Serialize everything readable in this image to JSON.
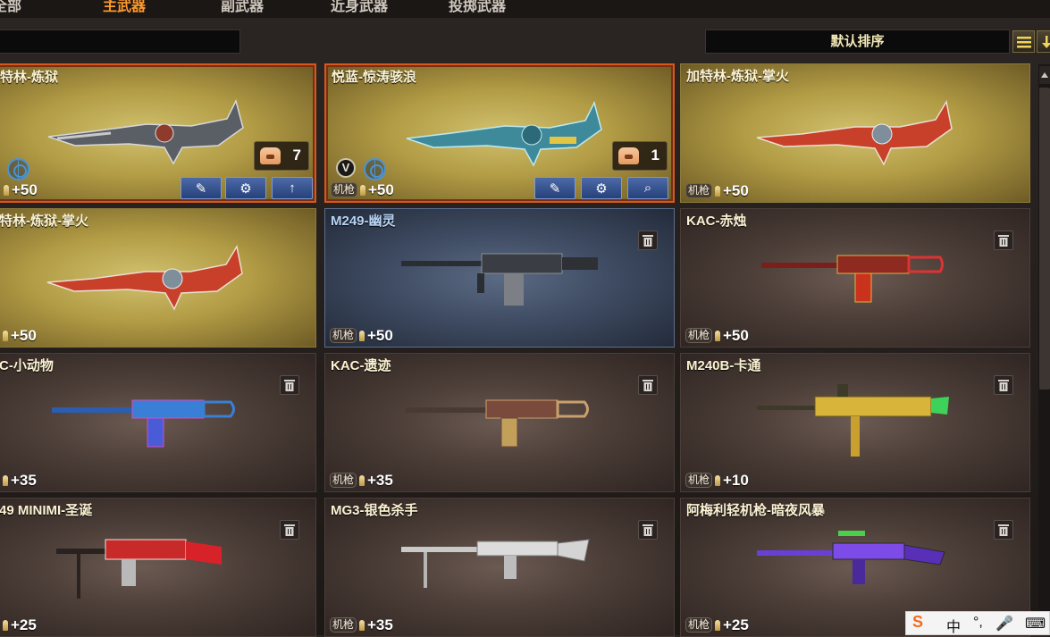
{
  "tabs": [
    {
      "label": "全部"
    },
    {
      "label": "主武器"
    },
    {
      "label": "副武器"
    },
    {
      "label": "近身武器"
    },
    {
      "label": "投掷武器"
    }
  ],
  "search": {
    "placeholder": ""
  },
  "sort": {
    "label": "默认排序"
  },
  "icons": {
    "list": "list-view-icon",
    "sort_direction": "sort-down-icon",
    "trash": "trash-icon",
    "wrench": "wrench-icon",
    "gear": "gear-icon",
    "upgrade": "up-arrow-icon",
    "search": "magnifier-icon",
    "ammo": "bullet-icon"
  },
  "colors": {
    "tab_active": "#ff9a2a",
    "gold_card": "#b29c45",
    "blue_card": "#3f4c63",
    "normal_card": "#4b3d37",
    "selected_border": "#d35a1c"
  },
  "cards": [
    {
      "title": "特林-炼狱",
      "tag": "",
      "ammo": "+50",
      "count": "7",
      "btns": [
        "⚙",
        "⚙",
        "↑"
      ]
    },
    {
      "title": "悦蓝-惊涛骇浪",
      "tag": "机枪",
      "ammo": "+50",
      "count": "1",
      "badge": "V",
      "btns": [
        "⚙",
        "⚙",
        "🔍"
      ]
    },
    {
      "title": "加特林-炼狱-掌火",
      "tag": "机枪",
      "ammo": "+50"
    },
    {
      "title": "特林-炼狱-掌火",
      "tag": "",
      "ammo": "+50"
    },
    {
      "title": "M249-幽灵",
      "tag": "机枪",
      "ammo": "+50"
    },
    {
      "title": "KAC-赤烛",
      "tag": "机枪",
      "ammo": "+50"
    },
    {
      "title": "C-小动物",
      "tag": "",
      "ammo": "+35"
    },
    {
      "title": "KAC-遗迹",
      "tag": "机枪",
      "ammo": "+35"
    },
    {
      "title": "M240B-卡通",
      "tag": "机枪",
      "ammo": "+10"
    },
    {
      "title": "49 MINIMI-圣诞",
      "tag": "",
      "ammo": "+25"
    },
    {
      "title": "MG3-银色杀手",
      "tag": "机枪",
      "ammo": "+35"
    },
    {
      "title": "阿梅利轻机枪-暗夜风暴",
      "tag": "机枪",
      "ammo": "+25"
    }
  ],
  "ime": {
    "logo": "S",
    "lang": "中",
    "punct": "°,",
    "mic": "🎤",
    "keyboard": "⌨"
  }
}
